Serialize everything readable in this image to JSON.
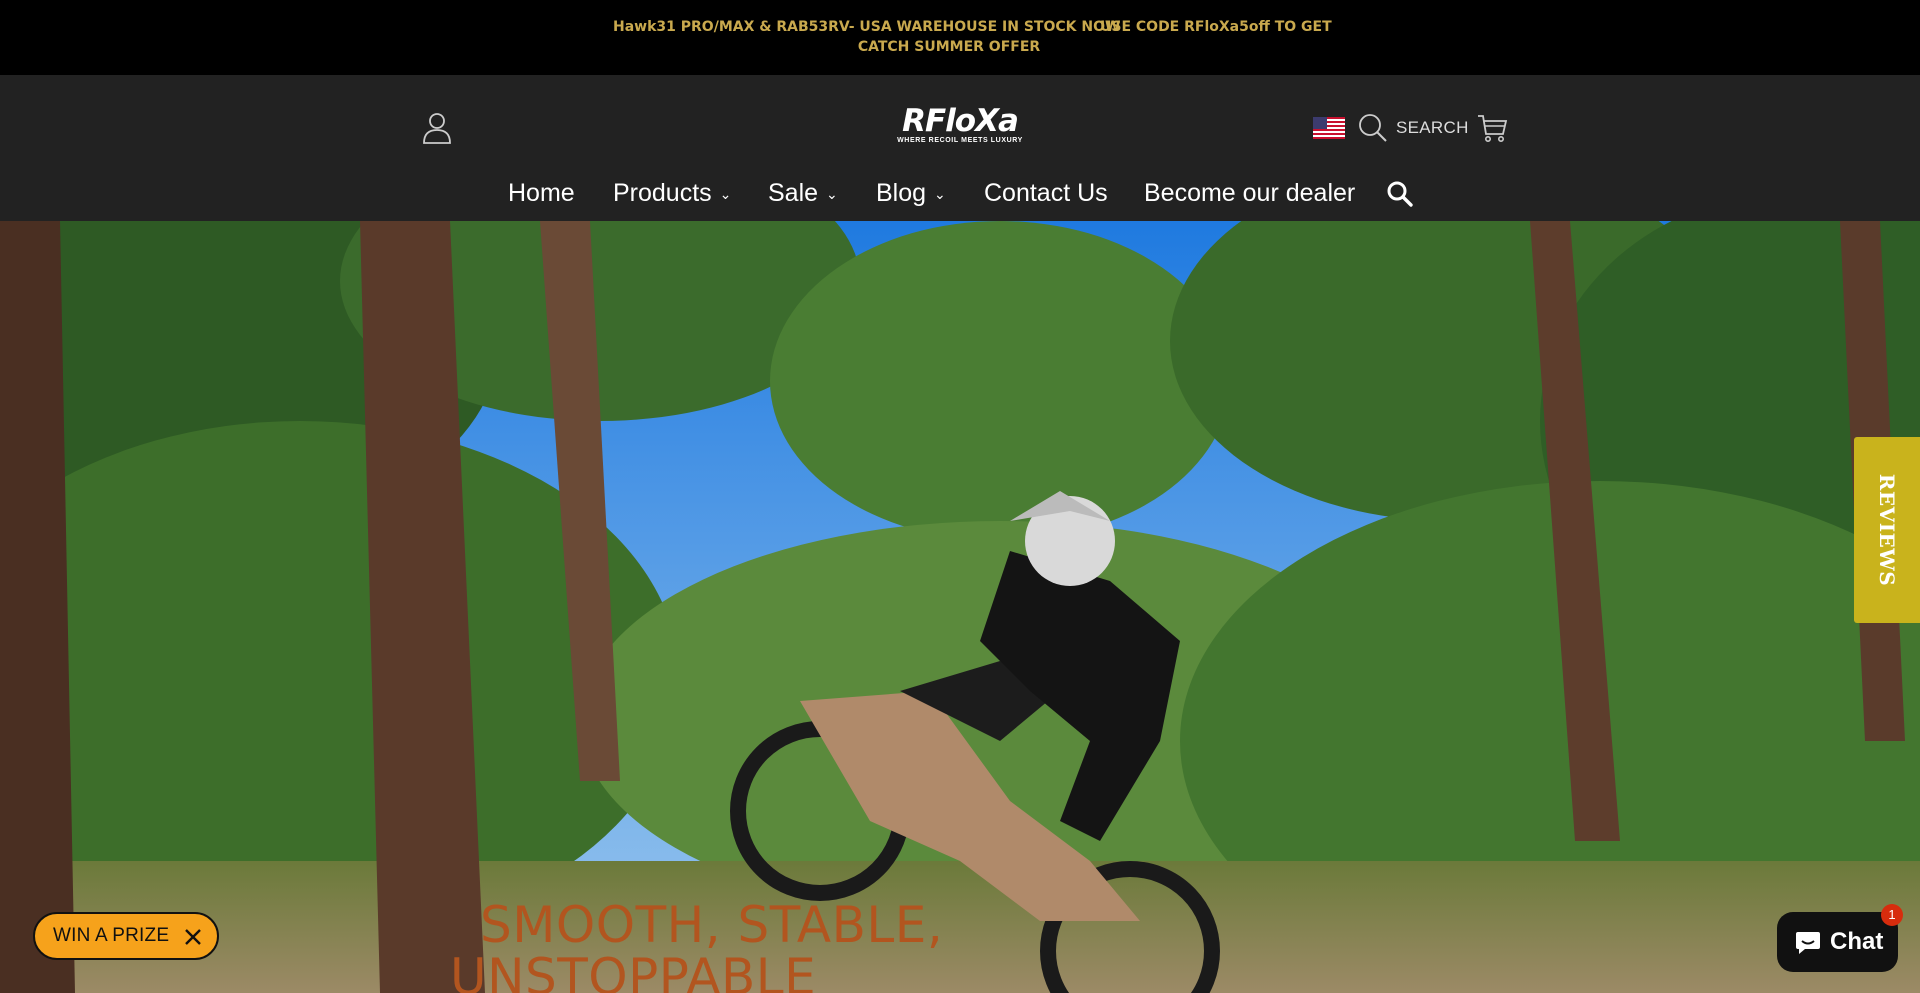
{
  "announcement": {
    "line1_left": "Hawk31 PRO/MAX & RAB53RV- USA WAREHOUSE IN STOCK NOW",
    "line1_right": "USE CODE RFloXa5off TO GET",
    "line2": "CATCH SUMMER OFFER"
  },
  "header": {
    "logo_text": "RFloXa",
    "logo_tagline": "WHERE RECOIL MEETS LUXURY",
    "search_label": "SEARCH",
    "flag_icon": "us-flag-icon"
  },
  "nav": {
    "items": [
      {
        "label": "Home",
        "dropdown": false
      },
      {
        "label": "Products",
        "dropdown": true
      },
      {
        "label": "Sale",
        "dropdown": true
      },
      {
        "label": "Blog",
        "dropdown": true
      },
      {
        "label": "Contact Us",
        "dropdown": false
      },
      {
        "label": "Become our dealer",
        "dropdown": false
      }
    ],
    "chevron": "⌄"
  },
  "hero": {
    "title_line1": "SMOOTH, STABLE,",
    "title_line2": "UNSTOPPABLE"
  },
  "reviews_tab": {
    "label": "REVIEWS"
  },
  "prize": {
    "label": "WIN A PRIZE",
    "gift_glyph": ""
  },
  "chat": {
    "label": "Chat",
    "badge": "1"
  },
  "colors": {
    "announce_text": "#c9a94e",
    "header_bg": "#222222",
    "hero_title": "#b2551f",
    "reviews_bg": "#c9b31c",
    "prize_bg": "#f6a21b"
  }
}
